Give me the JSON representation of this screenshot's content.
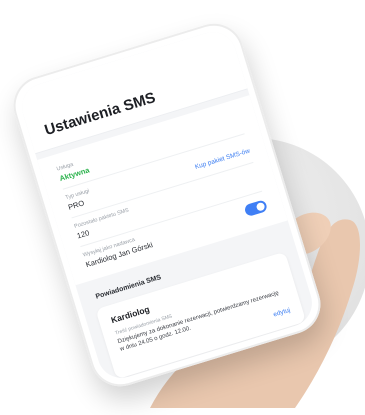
{
  "screen": {
    "title": "Ustawienia SMS"
  },
  "settings": {
    "status_label": "Usługa",
    "status_value": "Aktywna",
    "plan_label": "Typ usługi",
    "plan_value": "PRO",
    "plan_link": "Kup pakiet SMS-ów",
    "remaining_label": "Pozostało pakietu SMS",
    "remaining_value": "120",
    "sender_label": "Wysyłaj jako nadawca",
    "sender_value": "Kardiolog Jan Górski"
  },
  "notifications": {
    "header": "Powiadomienia SMS",
    "toggle_state": "on",
    "card": {
      "title": "Kardiolog",
      "label": "Treść powiadomienia SMS",
      "text": "Dziękujemy za dokonanie rezerwacji, potwierdzamy rezerwację w dniu 24.05 o godz. 12.00.",
      "action": "edytuj"
    }
  },
  "colors": {
    "accent": "#3c7ef2",
    "active": "#2bb24c"
  }
}
